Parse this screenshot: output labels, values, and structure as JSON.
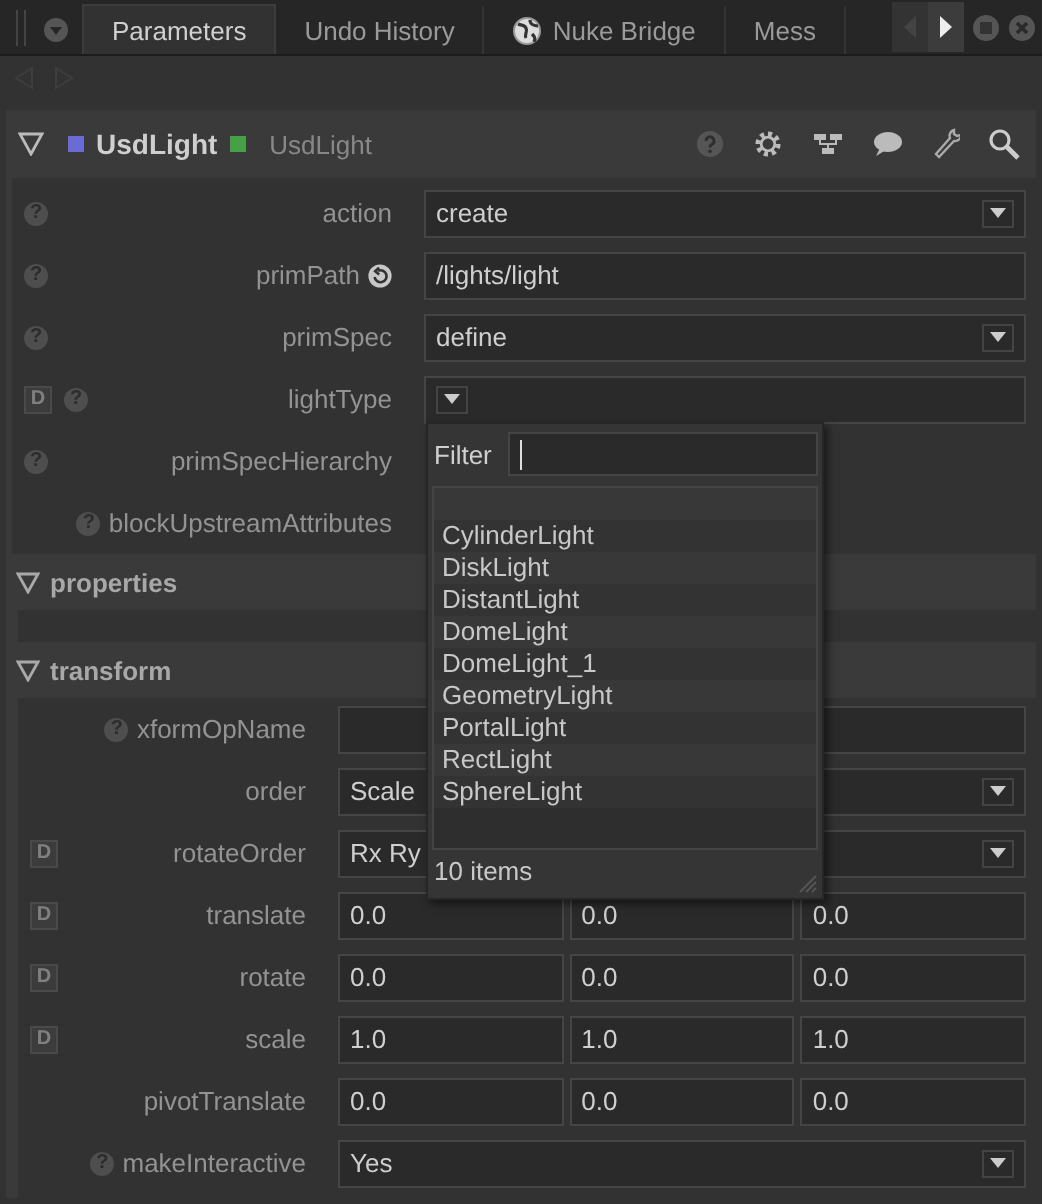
{
  "tabs": [
    {
      "label": "Parameters",
      "selected": true,
      "globe_icon": false
    },
    {
      "label": "Undo History",
      "selected": false,
      "globe_icon": false
    },
    {
      "label": "Nuke Bridge",
      "selected": false,
      "globe_icon": true
    },
    {
      "label": "Mess",
      "selected": false,
      "globe_icon": false
    }
  ],
  "node": {
    "name": "UsdLight",
    "class_name": "UsdLight",
    "expanded": true
  },
  "params": [
    {
      "label": "action",
      "help": "?",
      "kind": "dropdown",
      "value": "create"
    },
    {
      "label": "primPath",
      "help": "?",
      "kind": "path",
      "value": "/lights/light"
    },
    {
      "label": "primSpec",
      "help": "?",
      "kind": "dropdown",
      "value": "define"
    },
    {
      "label": "lightType",
      "help": "?",
      "badge": "D",
      "kind": "dropdown"
    },
    {
      "label": "primSpecHierarchy",
      "help": "?",
      "kind": "label"
    },
    {
      "label": "blockUpstreamAttributes",
      "help": "?",
      "kind": "label"
    }
  ],
  "sections": [
    {
      "title": "properties",
      "expanded": true
    },
    {
      "title": "transform",
      "expanded": true,
      "params": [
        {
          "label": "xformOpName",
          "help": "?",
          "kind": "text"
        },
        {
          "label": "order",
          "kind": "dropdown",
          "value": "Scale"
        },
        {
          "label": "rotateOrder",
          "badge": "D",
          "kind": "dropdown",
          "value": "Rx Ry"
        },
        {
          "label": "translate",
          "badge": "D",
          "kind": "triple",
          "values": [
            "0.0",
            "0.0",
            "0.0"
          ]
        },
        {
          "label": "rotate",
          "badge": "D",
          "kind": "triple",
          "values": [
            "0.0",
            "0.0",
            "0.0"
          ]
        },
        {
          "label": "scale",
          "badge": "D",
          "kind": "triple",
          "values": [
            "1.0",
            "1.0",
            "1.0"
          ]
        },
        {
          "label": "pivotTranslate",
          "kind": "triple",
          "values": [
            "0.0",
            "0.0",
            "0.0"
          ]
        },
        {
          "label": "makeInteractive",
          "help": "?",
          "kind": "dropdown",
          "value": "Yes"
        }
      ]
    }
  ],
  "popup": {
    "filter_label": "Filter",
    "items": [
      "CylinderLight",
      "DiskLight",
      "DistantLight",
      "DomeLight",
      "DomeLight_1",
      "GeometryLight",
      "PortalLight",
      "RectLight",
      "SphereLight"
    ],
    "count": "10 items"
  }
}
